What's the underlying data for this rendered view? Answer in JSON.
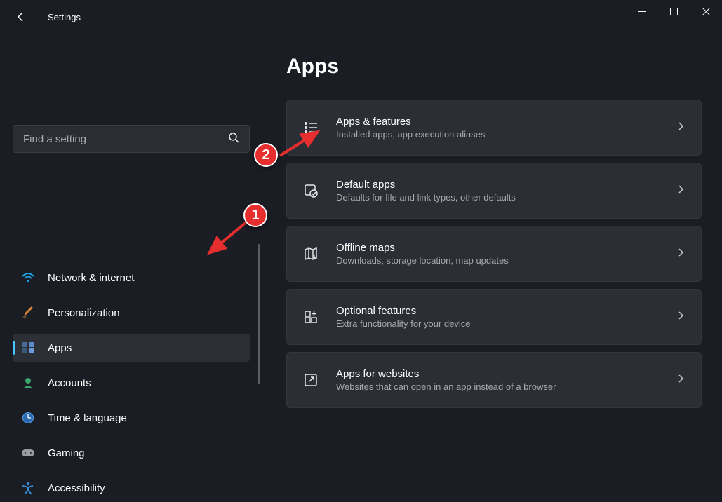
{
  "app": {
    "title": "Settings"
  },
  "search": {
    "placeholder": "Find a setting"
  },
  "page": {
    "title": "Apps"
  },
  "nav": {
    "items": [
      {
        "label": "Network & internet"
      },
      {
        "label": "Personalization"
      },
      {
        "label": "Apps"
      },
      {
        "label": "Accounts"
      },
      {
        "label": "Time & language"
      },
      {
        "label": "Gaming"
      },
      {
        "label": "Accessibility"
      }
    ]
  },
  "cards": [
    {
      "title": "Apps & features",
      "sub": "Installed apps, app execution aliases"
    },
    {
      "title": "Default apps",
      "sub": "Defaults for file and link types, other defaults"
    },
    {
      "title": "Offline maps",
      "sub": "Downloads, storage location, map updates"
    },
    {
      "title": "Optional features",
      "sub": "Extra functionality for your device"
    },
    {
      "title": "Apps for websites",
      "sub": "Websites that can open in an app instead of a browser"
    }
  ],
  "annotations": {
    "marker1": "1",
    "marker2": "2"
  }
}
